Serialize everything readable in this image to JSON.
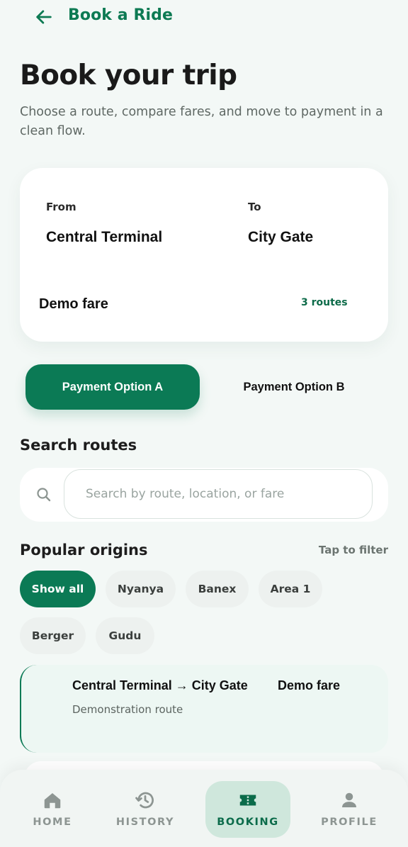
{
  "header": {
    "title": "Book a Ride",
    "back_icon": "arrow-left-icon"
  },
  "page": {
    "title": "Book your trip",
    "subtitle": "Choose a route, compare fares, and move to payment in a clean flow."
  },
  "trip_card": {
    "from_label": "From",
    "from_value": "Central Terminal",
    "to_label": "To",
    "to_value": "City Gate",
    "fare_label": "Demo fare",
    "routes_count": "3 routes"
  },
  "payment": {
    "option_a": "Payment Option A",
    "option_b": "Payment Option B",
    "selected": "Payment Option A"
  },
  "search": {
    "heading": "Search routes",
    "placeholder": "Search by route, location, or fare",
    "value": ""
  },
  "origins": {
    "heading": "Popular origins",
    "hint": "Tap to filter",
    "chips": [
      "Show all",
      "Nyanya",
      "Banex",
      "Area 1",
      "Berger",
      "Gudu"
    ],
    "active": "Show all"
  },
  "results": [
    {
      "route": "Central Terminal → City Gate",
      "fare": "Demo fare",
      "note": "Demonstration route"
    }
  ],
  "nav": {
    "items": [
      {
        "label": "HOME",
        "icon": "home-icon"
      },
      {
        "label": "HISTORY",
        "icon": "history-icon"
      },
      {
        "label": "BOOKING",
        "icon": "ticket-icon"
      },
      {
        "label": "PROFILE",
        "icon": "person-icon"
      }
    ],
    "active": "BOOKING"
  },
  "colors": {
    "accent": "#0b7a55",
    "background": "#f3f8f6",
    "accent_soft": "#cfe7dc"
  }
}
